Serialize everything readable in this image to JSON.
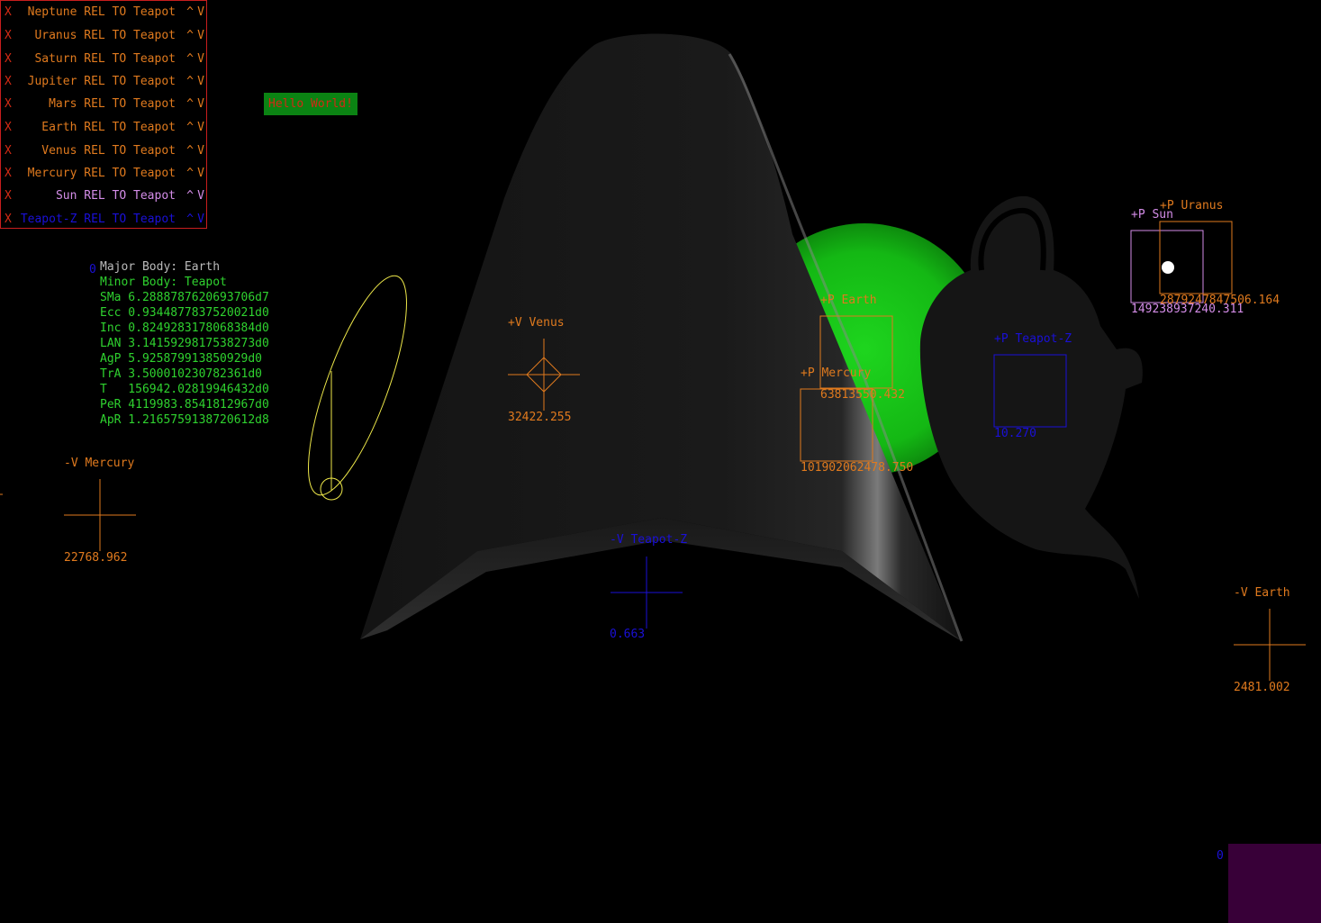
{
  "colors": {
    "orange": "#e07a1e",
    "red": "#d12a14",
    "blue": "#1a10d8",
    "pink": "#d48de8",
    "green": "#2fd22f",
    "grey": "#bbbbbb",
    "yellow": "#efe94a",
    "button_bg": "#0b8313",
    "panel_border": "#c81e1e",
    "planet": "#16c416"
  },
  "tracking": {
    "close_label": "X",
    "up_label": "^",
    "down_label": "V",
    "rows": [
      {
        "label": "Neptune REL TO Teapot",
        "color": "#e07a1e"
      },
      {
        "label": "Uranus REL TO Teapot",
        "color": "#e07a1e"
      },
      {
        "label": "Saturn REL TO Teapot",
        "color": "#e07a1e"
      },
      {
        "label": "Jupiter REL TO Teapot",
        "color": "#e07a1e"
      },
      {
        "label": "Mars REL TO Teapot",
        "color": "#e07a1e"
      },
      {
        "label": "Earth REL TO Teapot",
        "color": "#e07a1e"
      },
      {
        "label": "Venus REL TO Teapot",
        "color": "#e07a1e"
      },
      {
        "label": "Mercury REL TO Teapot",
        "color": "#e07a1e"
      },
      {
        "label": "Sun REL TO Teapot",
        "color": "#d48de8"
      },
      {
        "label": "Teapot-Z REL TO Teapot",
        "color": "#1a10d8"
      }
    ]
  },
  "hello_button": {
    "label": "Hello World!"
  },
  "orbit": {
    "corner_zero": "0",
    "major_body": "Major Body: Earth",
    "minor_body": "Minor Body: Teapot",
    "elements": [
      "SMa 6.288878762069370​6d7",
      "Ecc 0.934487783752002​1d0",
      "Inc 0.824928317806838​4d0",
      "LAN 3.141592981753827​3d0",
      "AgP 5.925879913850929d0",
      "TrA 3.500010230782361d0",
      "T   156942.0281994643​2d0",
      "PeR 4119983.854181296​7d0",
      "ApR 1.216575913872061​2d8"
    ]
  },
  "markers": {
    "venus_vel": {
      "title": "+V Venus",
      "value": "32422.255"
    },
    "mercury_vel": {
      "title": "-V Mercury",
      "value": "22768.962"
    },
    "teapotz_vel": {
      "title": "-V Teapot-Z",
      "value": "0.663"
    },
    "earth_vel": {
      "title": "-V Earth",
      "value": "2481.002"
    },
    "earth_pos": {
      "title": "+P Earth",
      "value": "63813550.432"
    },
    "mercury_pos": {
      "title": "+P Mercury",
      "value": "101902062478.750"
    },
    "teapotz_pos": {
      "title": "+P Teapot-Z",
      "value": "10.270"
    },
    "sun_pos": {
      "title": "+P Sun",
      "value": "149238937240.311"
    },
    "uranus_pos": {
      "title": "+P Uranus",
      "value": "2879247847506.164"
    }
  },
  "corner_zero_bottom": "0"
}
